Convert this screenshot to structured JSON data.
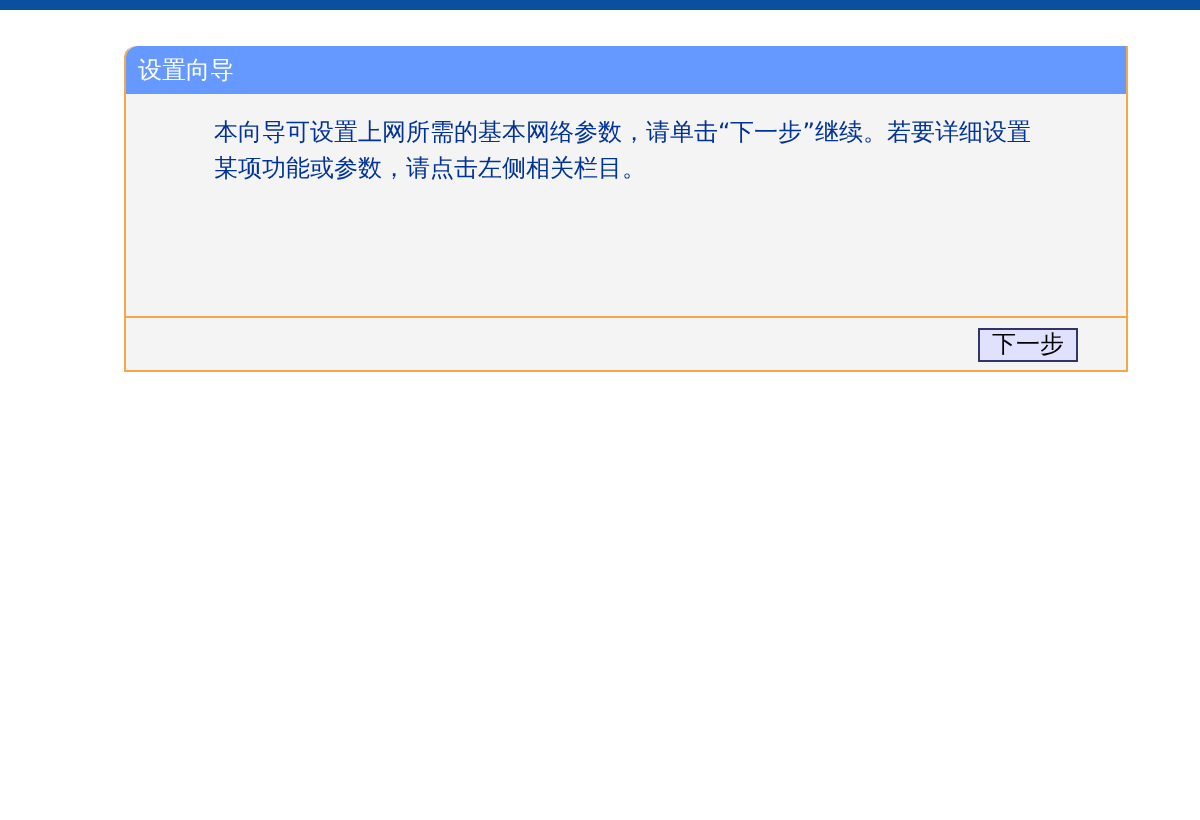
{
  "panel": {
    "title": "设置向导",
    "message": "本向导可设置上网所需的基本网络参数，请单击“下一步”继续。若要详细设置某项功能或参数，请点击左侧相关栏目。",
    "button": "下一步"
  }
}
